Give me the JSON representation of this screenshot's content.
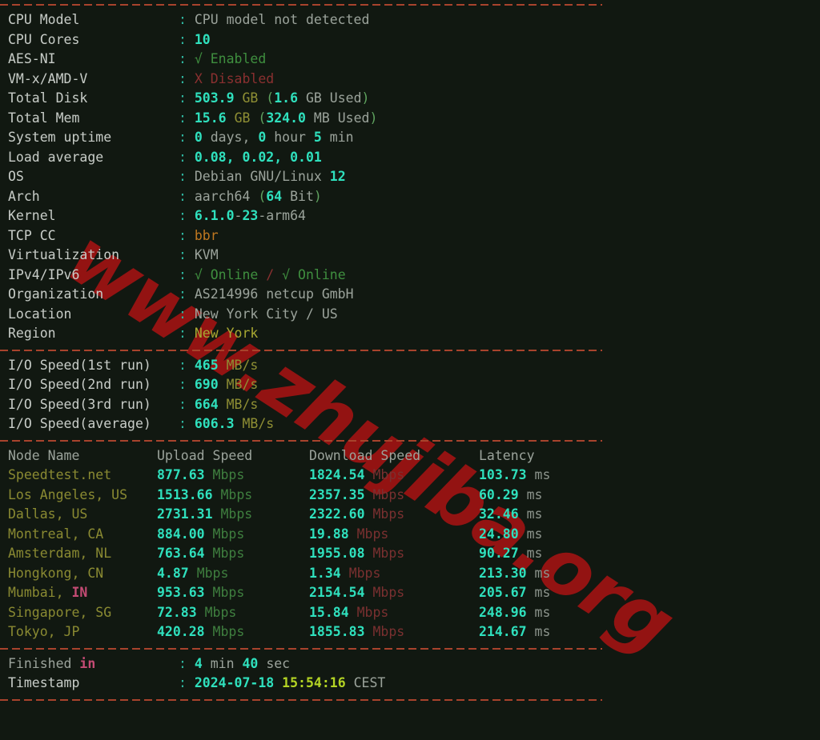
{
  "watermark": {
    "text": "www.zhujiba.org",
    "color": "#9d1313"
  },
  "theme": {
    "background": "#111811",
    "label": "#c8cdc8",
    "colon": "#2fb6a0",
    "separator": "#a8432c",
    "value_cyan": "#2fe0bd",
    "value_grey": "#9ba39b",
    "value_green": "#3f8f3f",
    "value_red": "#8a3030",
    "value_olive": "#8f8f34",
    "value_orange": "#c07820",
    "value_pink": "#c44b74",
    "value_lime": "#b4d424"
  },
  "system": {
    "rows": [
      {
        "label": "CPU Model",
        "value": "CPU model not detected"
      },
      {
        "label": "CPU Cores",
        "value": "10"
      },
      {
        "label": "AES-NI",
        "value": "√ Enabled"
      },
      {
        "label": "VM-x/AMD-V",
        "value": "X Disabled"
      },
      {
        "label": "Total Disk",
        "value": "503.9 GB (1.6 GB Used)",
        "number": "503.9",
        "unit": "GB",
        "used_number": "1.6",
        "used_unit": "GB Used"
      },
      {
        "label": "Total Mem",
        "value": "15.6 GB (324.0 MB Used)",
        "number": "15.6",
        "unit": "GB",
        "used_number": "324.0",
        "used_unit": "MB Used"
      },
      {
        "label": "System uptime",
        "value": "0 days, 0 hour 5 min",
        "days": "0",
        "days_word": "days,",
        "hours": "0",
        "hours_word": "hour",
        "mins": "5",
        "mins_word": "min"
      },
      {
        "label": "Load average",
        "value": "0.08, 0.02, 0.01"
      },
      {
        "label": "OS",
        "value": "Debian GNU/Linux 12",
        "name": "Debian GNU/Linux",
        "version": "12"
      },
      {
        "label": "Arch",
        "value": "aarch64 (64 Bit)",
        "arch": "aarch64",
        "bits": "64",
        "bits_word": "Bit"
      },
      {
        "label": "Kernel",
        "value": "6.1.0-23-arm64",
        "ver": "6.1.0",
        "dash1": "-",
        "rev": "23",
        "suffix": "-arm64"
      },
      {
        "label": "TCP CC",
        "value": "bbr"
      },
      {
        "label": "Virtualization",
        "value": "KVM"
      },
      {
        "label": "IPv4/IPv6",
        "value": "√ Online / √ Online",
        "ipv4": "√ Online",
        "divider": " / ",
        "ipv6": "√ Online"
      },
      {
        "label": "Organization",
        "value": "AS214996 netcup GmbH"
      },
      {
        "label": "Location",
        "value": "New York City / US"
      },
      {
        "label": "Region",
        "value": "New York"
      }
    ]
  },
  "io": {
    "rows": [
      {
        "label": "I/O Speed(1st run)",
        "value": "465",
        "unit": "MB/s"
      },
      {
        "label": "I/O Speed(2nd run)",
        "value": "690",
        "unit": "MB/s"
      },
      {
        "label": "I/O Speed(3rd run)",
        "value": "664",
        "unit": "MB/s"
      },
      {
        "label": "I/O Speed(average)",
        "value": "606.3",
        "unit": "MB/s"
      }
    ]
  },
  "speedtest": {
    "headers": [
      "Node Name",
      "Upload Speed",
      "Download Speed",
      "Latency"
    ],
    "unit_upload": "Mbps",
    "unit_download": "Mbps",
    "unit_latency": "ms",
    "rows": [
      {
        "node": "Speedtest.net",
        "node_cc": "",
        "upload": "877.63",
        "download": "1824.54",
        "latency": "103.73"
      },
      {
        "node": "Los Angeles, US",
        "node_cc": "",
        "upload": "1513.66",
        "download": "2357.35",
        "latency": "60.29"
      },
      {
        "node": "Dallas, US",
        "node_cc": "",
        "upload": "2731.31",
        "download": "2322.60",
        "latency": "32.46"
      },
      {
        "node": "Montreal, CA",
        "node_cc": "",
        "upload": "884.00",
        "download": "19.88",
        "latency": "24.80"
      },
      {
        "node": "Amsterdam, NL",
        "node_cc": "",
        "upload": "763.64",
        "download": "1955.08",
        "latency": "90.27"
      },
      {
        "node": "Hongkong, CN",
        "node_cc": "",
        "upload": "4.87",
        "download": "1.34",
        "latency": "213.30"
      },
      {
        "node": "Mumbai, ",
        "node_cc": "IN",
        "upload": "953.63",
        "download": "2154.54",
        "latency": "205.67"
      },
      {
        "node": "Singapore, SG",
        "node_cc": "",
        "upload": "72.83",
        "download": "15.84",
        "latency": "248.96"
      },
      {
        "node": "Tokyo, JP",
        "node_cc": "",
        "upload": "420.28",
        "download": "1855.83",
        "latency": "214.67"
      }
    ]
  },
  "footer": {
    "finished_label_a": "Finished ",
    "finished_label_b": "in",
    "finished_min": "4",
    "finished_min_word": "min",
    "finished_sec": "40",
    "finished_sec_word": "sec",
    "timestamp_label": "Timestamp",
    "timestamp_date": "2024-07-18",
    "timestamp_time": "15:54:16",
    "timestamp_tz": "CEST"
  }
}
